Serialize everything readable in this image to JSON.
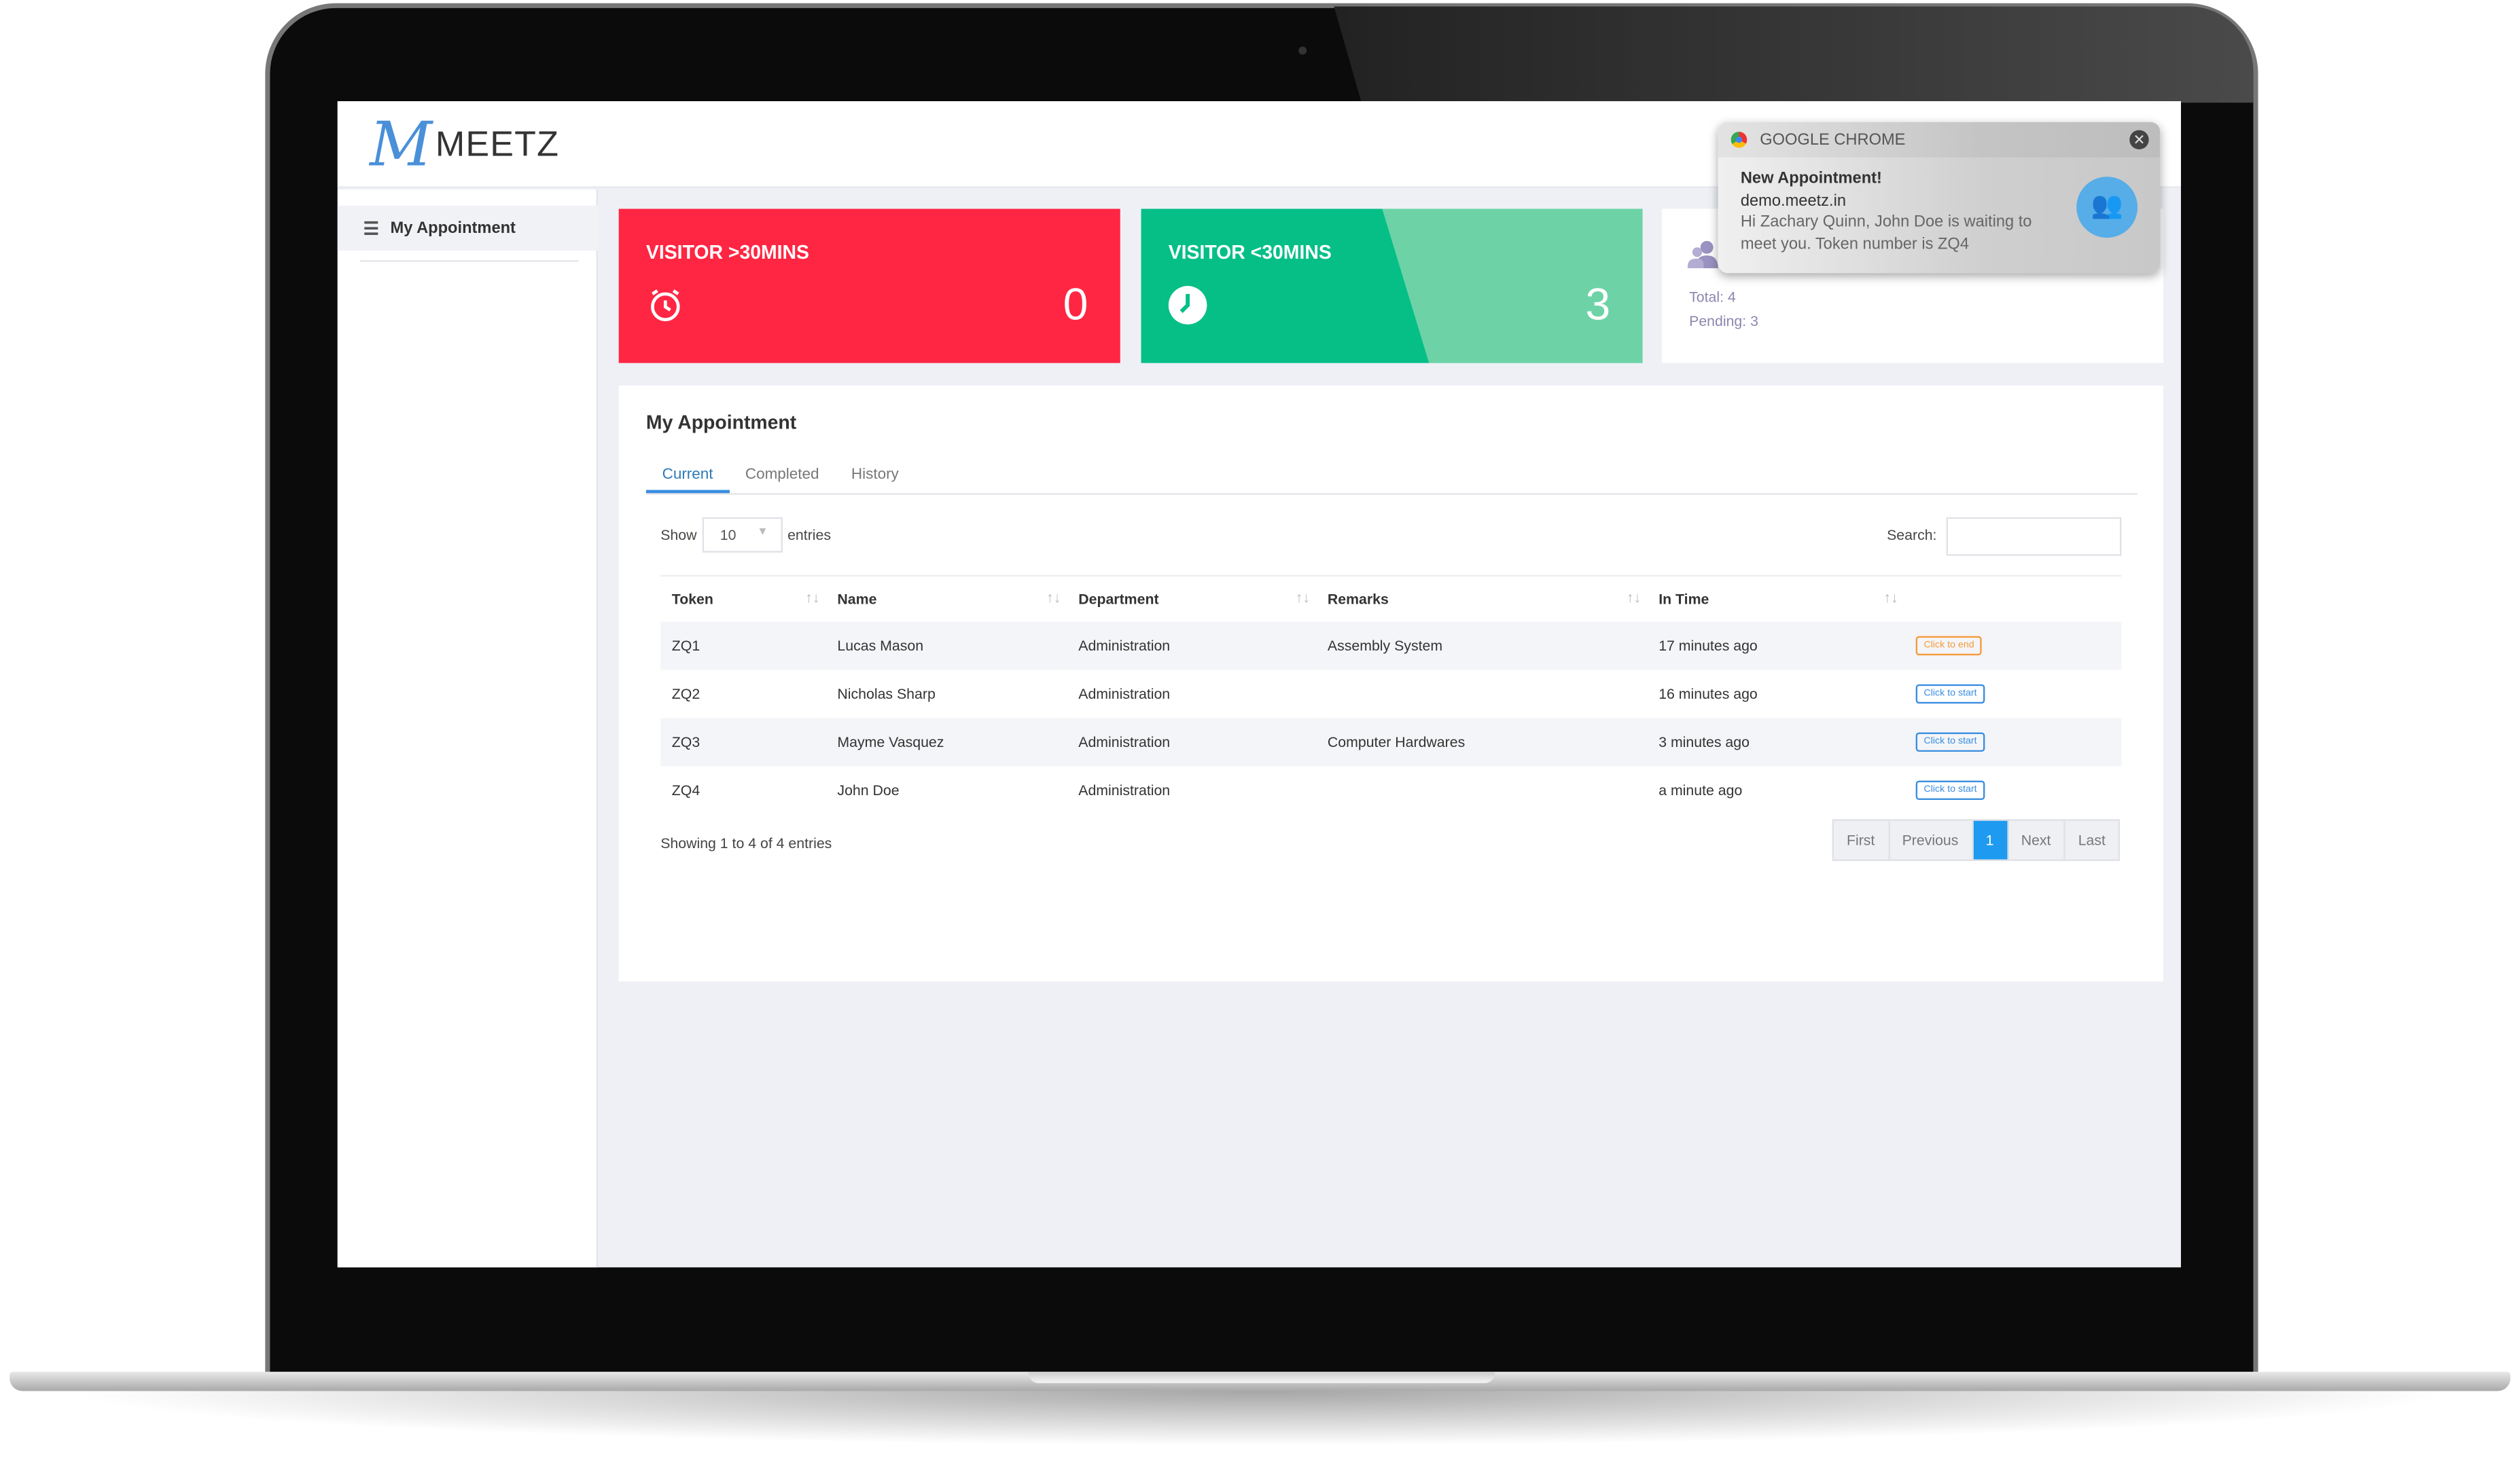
{
  "app": {
    "logo_text": "MEETZ"
  },
  "sidebar": {
    "items": [
      {
        "label": "My Appointment",
        "icon": "list-icon"
      }
    ]
  },
  "cards": [
    {
      "label": "VISITOR >30MINS",
      "value": "0",
      "icon": "alarm-clock-icon",
      "color": "#ff2643"
    },
    {
      "label": "VISITOR <30MINS",
      "value": "3",
      "icon": "clock-icon",
      "color": "#05bf87"
    },
    {
      "icon": "users-icon",
      "total": "Total: 4",
      "pending": "Pending: 3"
    }
  ],
  "panel": {
    "title": "My Appointment",
    "tabs": [
      "Current",
      "Completed",
      "History"
    ],
    "active_tab": "Current",
    "show_label": "Show",
    "entries_label": "entries",
    "page_length": "10",
    "search_label": "Search:",
    "search_value": "",
    "columns": [
      "Token",
      "Name",
      "Department",
      "Remarks",
      "In Time",
      ""
    ],
    "rows": [
      {
        "token": "ZQ1",
        "name": "Lucas Mason",
        "department": "Administration",
        "remarks": "Assembly System",
        "in_time": "17 minutes ago",
        "action": "Click to end"
      },
      {
        "token": "ZQ2",
        "name": "Nicholas Sharp",
        "department": "Administration",
        "remarks": "",
        "in_time": "16 minutes ago",
        "action": "Click to start"
      },
      {
        "token": "ZQ3",
        "name": "Mayme Vasquez",
        "department": "Administration",
        "remarks": "Computer Hardwares",
        "in_time": "3 minutes ago",
        "action": "Click to start"
      },
      {
        "token": "ZQ4",
        "name": "John Doe",
        "department": "Administration",
        "remarks": "",
        "in_time": "a minute ago",
        "action": "Click to start"
      }
    ],
    "info": "Showing 1 to 4 of 4 entries",
    "pagination": {
      "first": "First",
      "previous": "Previous",
      "current": "1",
      "next": "Next",
      "last": "Last"
    }
  },
  "notification": {
    "source": "GOOGLE CHROME",
    "title": "New Appointment!",
    "site": "demo.meetz.in",
    "message": "Hi Zachary Quinn, John Doe is waiting to meet you. Token number is ZQ4"
  }
}
